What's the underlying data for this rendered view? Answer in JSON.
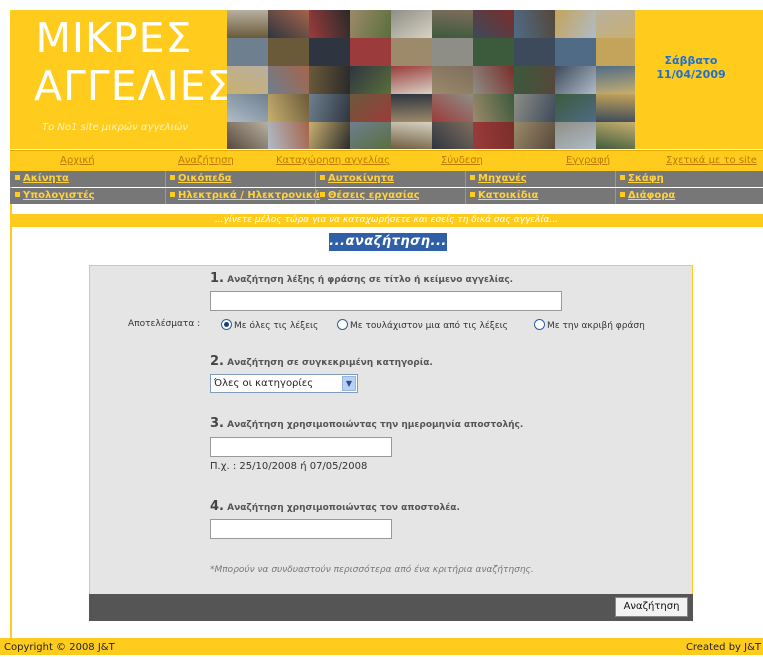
{
  "header": {
    "title_line1": "ΜΙΚΡΕΣ",
    "title_line2": "ΑΓΓΕΛΙΕΣ",
    "subtitle": "Το No1 site μικρών αγγελιών",
    "day": "Σάββατο",
    "date": "11/04/2009"
  },
  "nav": [
    "Αρχική",
    "Αναζήτηση",
    "Καταχώρηση αγγελίας",
    "Σύνδεση",
    "Εγγραφή",
    "Σχετικά με το site"
  ],
  "categories": {
    "row1": [
      "Ακίνητα",
      "Οικόπεδα",
      "Αυτοκίνητα",
      "Μηχανές",
      "Σκάφη"
    ],
    "row2": [
      "Υπολογιστές",
      "Ηλεκτρικά / Ηλεκτρονικά",
      "Θέσεις εργασίας",
      "Κατοικίδια",
      "Διάφορα"
    ]
  },
  "slogan": "...γίνετε μέλος τώρα για να καταχωρήσετε και εσείς τη δικά σας αγγελία...",
  "search_heading": "...αναζήτηση...",
  "q1": {
    "num": "1.",
    "text": "Αναζήτηση λέξης ή φράσης σε τίτλο ή κείμενο αγγελίας.",
    "value": ""
  },
  "results": {
    "label": "Αποτελέσματα :",
    "options": [
      "Με όλες τις λέξεις",
      "Με τουλάχιστον μια από τις λέξεις",
      "Με την ακριβή φράση"
    ],
    "selected": "Με όλες τις λέξεις"
  },
  "q2": {
    "num": "2.",
    "text": "Αναζήτηση σε συγκεκριμένη κατηγορία.",
    "selected": "Όλες οι κατηγορίες"
  },
  "q3": {
    "num": "3.",
    "text": "Αναζήτηση χρησιμοποιώντας την ημερομηνία αποστολής.",
    "value": "",
    "hint": "Π.χ. : 25/10/2008 ή 07/05/2008"
  },
  "q4": {
    "num": "4.",
    "text": "Αναζήτηση χρησιμοποιώντας τον αποστολέα.",
    "value": ""
  },
  "note": "*Μπορούν να συνδυαστούν περισσότερα από ένα κριτήρια αναζήτησης.",
  "search_button": "Αναζήτηση",
  "footer": {
    "left": "Copyright © 2008 J&T",
    "right": "Created by J&T"
  },
  "colors": {
    "accent": "#ffcc1e",
    "category_bar": "#777777",
    "heading_bg": "#2f5fa7",
    "date_text": "#1f6fd0"
  }
}
